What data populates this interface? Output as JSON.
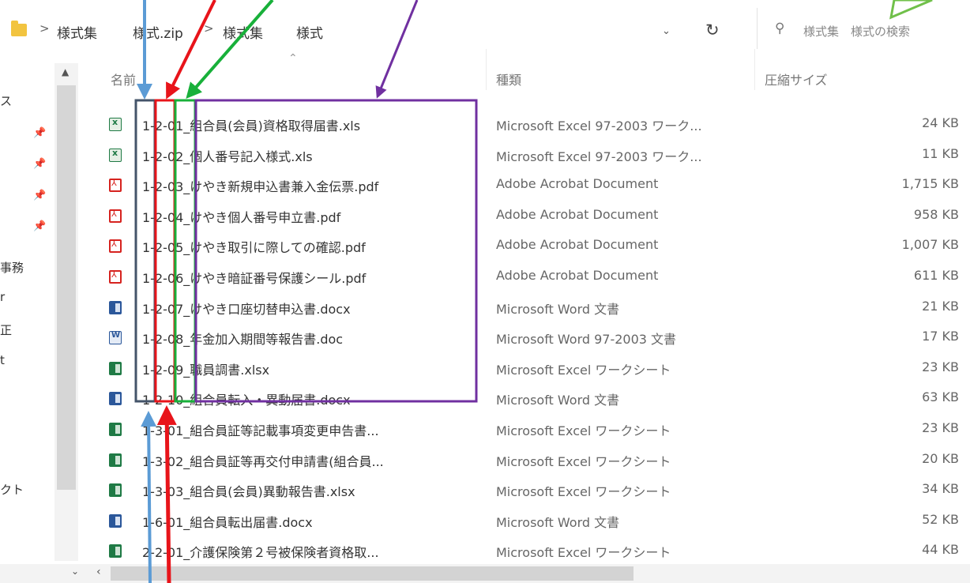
{
  "address": {
    "crumbs": [
      "様式集",
      "様式.zip",
      "様式集",
      "様式"
    ],
    "separator": ">"
  },
  "search": {
    "placeholder": "様式集　様式の検索"
  },
  "nav": {
    "items": [
      "ス",
      "事務",
      "r",
      "正",
      "t",
      "クト"
    ]
  },
  "columns": {
    "name": "名前",
    "type": "種類",
    "size": "圧縮サイズ"
  },
  "files": [
    {
      "icon": "xls",
      "name": "1-2-01_組合員(会員)資格取得届書.xls",
      "type": "Microsoft Excel 97-2003 ワーク...",
      "size": "24 KB"
    },
    {
      "icon": "xls",
      "name": "1-2-02_個人番号記入様式.xls",
      "type": "Microsoft Excel 97-2003 ワーク...",
      "size": "11 KB"
    },
    {
      "icon": "pdf",
      "name": "1-2-03_けやき新規申込書兼入金伝票.pdf",
      "type": "Adobe Acrobat Document",
      "size": "1,715 KB"
    },
    {
      "icon": "pdf",
      "name": "1-2-04_けやき個人番号申立書.pdf",
      "type": "Adobe Acrobat Document",
      "size": "958 KB"
    },
    {
      "icon": "pdf",
      "name": "1-2-05_けやき取引に際しての確認.pdf",
      "type": "Adobe Acrobat Document",
      "size": "1,007 KB"
    },
    {
      "icon": "pdf",
      "name": "1-2-06_けやき暗証番号保護シール.pdf",
      "type": "Adobe Acrobat Document",
      "size": "611 KB"
    },
    {
      "icon": "docx",
      "name": "1-2-07_けやき口座切替申込書.docx",
      "type": "Microsoft Word 文書",
      "size": "21 KB"
    },
    {
      "icon": "doc",
      "name": "1-2-08_年金加入期間等報告書.doc",
      "type": "Microsoft Word 97-2003 文書",
      "size": "17 KB"
    },
    {
      "icon": "xlsx",
      "name": "1-2-09_職員調書.xlsx",
      "type": "Microsoft Excel ワークシート",
      "size": "23 KB"
    },
    {
      "icon": "docx",
      "name": "1-2-10_組合員転入・異動届書.docx",
      "type": "Microsoft Word 文書",
      "size": "63 KB"
    },
    {
      "icon": "xlsx",
      "name": "1-3-01_組合員証等記載事項変更申告書...",
      "type": "Microsoft Excel ワークシート",
      "size": "23 KB"
    },
    {
      "icon": "xlsx",
      "name": "1-3-02_組合員証等再交付申請書(組合員...",
      "type": "Microsoft Excel ワークシート",
      "size": "20 KB"
    },
    {
      "icon": "xlsx",
      "name": "1-3-03_組合員(会員)異動報告書.xlsx",
      "type": "Microsoft Excel ワークシート",
      "size": "34 KB"
    },
    {
      "icon": "docx",
      "name": "1-6-01_組合員転出届書.docx",
      "type": "Microsoft Word 文書",
      "size": "52 KB"
    },
    {
      "icon": "xlsx",
      "name": "2-2-01_介護保険第２号被保険者資格取...",
      "type": "Microsoft Excel ワークシート",
      "size": "44 KB"
    }
  ],
  "colors": {
    "annotation_blue": "#5b9bd5",
    "annotation_red": "#e8141a",
    "annotation_green": "#18b03a",
    "annotation_purple": "#7030a0",
    "annotation_navy": "#44546a",
    "annotation_lightgreen": "#70c04a"
  }
}
